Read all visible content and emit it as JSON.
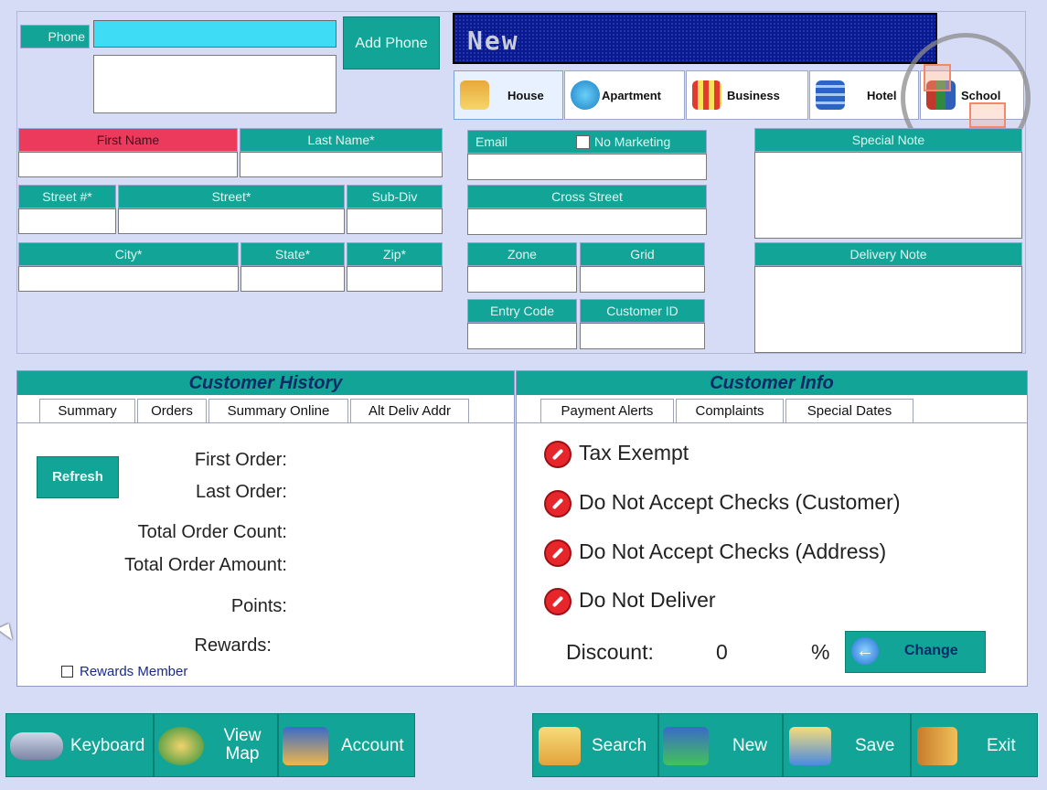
{
  "phone": {
    "label": "Phone",
    "value": "",
    "add_button": "Add Phone"
  },
  "status_banner": "New",
  "property_types": [
    {
      "label": "House",
      "icon": "house-icon"
    },
    {
      "label": "Apartment",
      "icon": "apartment-icon"
    },
    {
      "label": "Business",
      "icon": "business-icon"
    },
    {
      "label": "Hotel",
      "icon": "hotel-icon"
    },
    {
      "label": "School",
      "icon": "school-icon"
    }
  ],
  "name": {
    "first_label": "First Name",
    "last_label": "Last Name*"
  },
  "address": {
    "street_no_label": "Street #*",
    "street_label": "Street*",
    "subdiv_label": "Sub-Div",
    "city_label": "City*",
    "state_label": "State*",
    "zip_label": "Zip*"
  },
  "contact": {
    "email_label": "Email",
    "no_marketing_label": "No Marketing",
    "cross_street_label": "Cross Street",
    "zone_label": "Zone",
    "grid_label": "Grid",
    "entry_code_label": "Entry Code",
    "customer_id_label": "Customer ID"
  },
  "notes": {
    "special_label": "Special Note",
    "delivery_label": "Delivery Note"
  },
  "history": {
    "title": "Customer History",
    "tabs": [
      "Summary",
      "Orders",
      "Summary Online",
      "Alt Deliv Addr"
    ],
    "refresh": "Refresh",
    "first_order": "First Order:",
    "last_order": "Last Order:",
    "total_count": "Total Order Count:",
    "total_amount": "Total Order Amount:",
    "points": "Points:",
    "rewards": "Rewards:",
    "rewards_member": "Rewards Member"
  },
  "info": {
    "title": "Customer Info",
    "tabs": [
      "Payment Alerts",
      "Complaints",
      "Special Dates"
    ],
    "alerts": [
      "Tax Exempt",
      "Do Not Accept Checks (Customer)",
      "Do Not Accept Checks (Address)",
      "Do Not Deliver"
    ],
    "discount_label": "Discount:",
    "discount_value": "0",
    "percent": "%",
    "change": "Change"
  },
  "bottom": {
    "keyboard": "Keyboard",
    "view_map": "View Map",
    "account": "Account",
    "search": "Search",
    "new": "New",
    "save": "Save",
    "exit": "Exit"
  },
  "colors": {
    "teal": "#12a597",
    "bg": "#d6dcf5",
    "required_red": "#ec3a5c",
    "phone_cyan": "#3fdcf5",
    "banner": "#0a1a8c"
  }
}
